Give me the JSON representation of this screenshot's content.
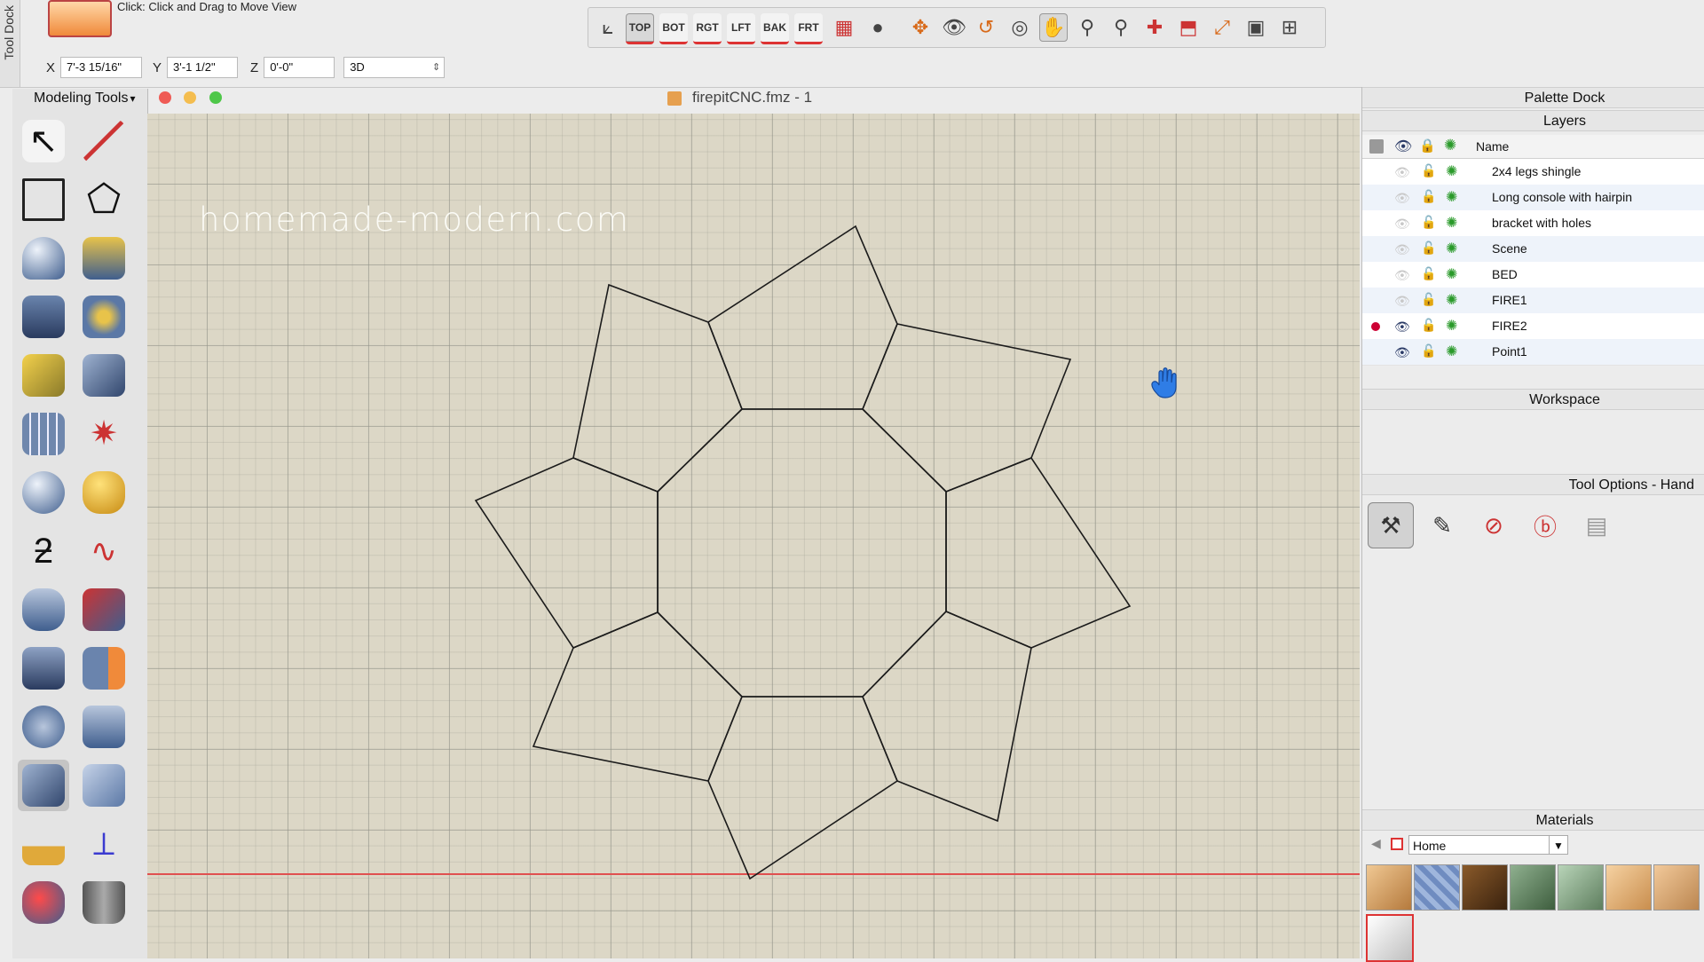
{
  "tool_dock": {
    "label": "Tool Dock"
  },
  "hint": "Click: Click and Drag to Move View",
  "coords": {
    "x_label": "X",
    "x_value": "7'-3 15/16\"",
    "y_label": "Y",
    "y_value": "3'-1 1/2\"",
    "z_label": "Z",
    "z_value": "0'-0\"",
    "view_mode": "3D"
  },
  "view_buttons": [
    "TOP",
    "BOT",
    "RGT",
    "LFT",
    "BAK",
    "FRT"
  ],
  "left_palette": {
    "title": "Modeling Tools"
  },
  "document": {
    "title": "firepitCNC.fmz - 1"
  },
  "canvas": {
    "watermark": "homemade-modern.com"
  },
  "palette_dock": {
    "title": "Palette Dock",
    "layers_title": "Layers",
    "name_header": "Name",
    "layers": [
      {
        "name": "2x4 legs shingle",
        "visible": false,
        "active": false
      },
      {
        "name": "Long console with hairpin",
        "visible": false,
        "active": false
      },
      {
        "name": "bracket with holes",
        "visible": false,
        "active": false
      },
      {
        "name": "Scene",
        "visible": false,
        "active": false
      },
      {
        "name": "BED",
        "visible": false,
        "active": false
      },
      {
        "name": "FIRE1",
        "visible": false,
        "active": false
      },
      {
        "name": "FIRE2",
        "visible": true,
        "active": true
      },
      {
        "name": "Point1",
        "visible": true,
        "active": false
      }
    ],
    "workspace_title": "Workspace",
    "tool_options_title": "Tool Options - Hand",
    "materials_title": "Materials",
    "materials_library": "Home"
  },
  "colors": {
    "canvas_bg": "#dcd7c6",
    "ground_line": "#e05050",
    "close": "#ef5b55",
    "minimize": "#f4bd4f",
    "zoom": "#4ec749"
  }
}
